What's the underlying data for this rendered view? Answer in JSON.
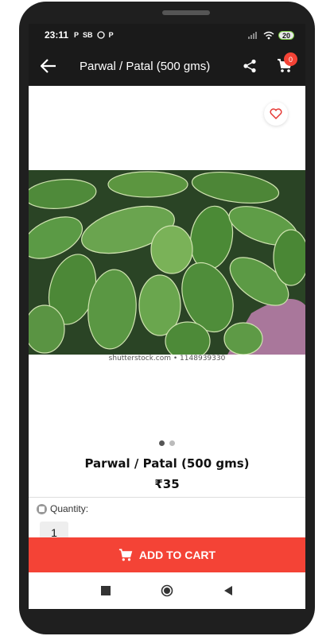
{
  "status_bar": {
    "time": "23:11",
    "notifications": [
      "P",
      "SB",
      "WA",
      "P"
    ],
    "battery": "20"
  },
  "app_bar": {
    "title": "Parwal / Patal (500 gms)",
    "cart_count": "0"
  },
  "product": {
    "image_caption": "shutterstock.com • 1148939330",
    "name": "Parwal / Patal (500 gms)",
    "price": "₹35",
    "quantity_label": "Quantity:",
    "quantity_value": "1"
  },
  "actions": {
    "add_to_cart": "ADD TO CART"
  },
  "colors": {
    "accent": "#f44336",
    "bar": "#1a1a1a"
  },
  "icons": {
    "back": "arrow-left-icon",
    "share": "share-icon",
    "cart": "cart-icon",
    "wishlist": "heart-icon"
  }
}
